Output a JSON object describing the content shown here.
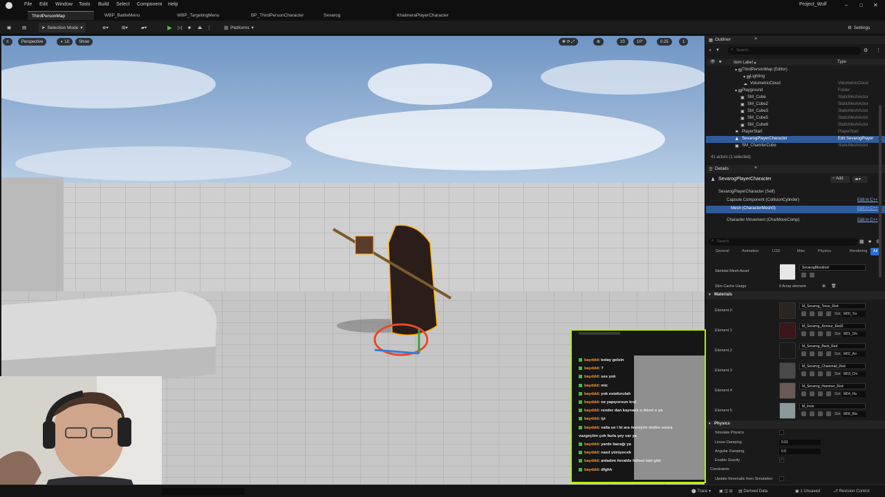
{
  "app": {
    "project": "Project_Wolf"
  },
  "menu": [
    "File",
    "Edit",
    "Window",
    "Tools",
    "Build",
    "Select",
    "Component",
    "Help"
  ],
  "tabs": [
    "ThirdPersonMap",
    "WBP_BattleMenu",
    "WBP_TargetingMenu",
    "BP_ThirdPersonCharacter",
    "Sevarog",
    "KhaimeraPlayerCharacter"
  ],
  "toolbar": {
    "mode": "Selection Mode",
    "platforms": "Platforms",
    "settings": "Settings"
  },
  "viewport": {
    "perspective": "Perspective",
    "lit": "Lit",
    "show": "Show",
    "grid_size": "10",
    "rot_snap": "10°",
    "scale_snap": "0.25",
    "cam_speed": "1"
  },
  "outliner": {
    "title": "Outliner",
    "search_placeholder": "Search",
    "col_label": "Item Label ▴",
    "col_type": "Type",
    "rows": [
      {
        "label": "ThirdPersonMap (Editor)",
        "type": ""
      },
      {
        "label": "Lighting",
        "type": ""
      },
      {
        "label": "VolumetricCloud",
        "type": "VolumetricCloud"
      },
      {
        "label": "Playground",
        "type": "Folder"
      },
      {
        "label": "SM_Cube",
        "type": "StaticMeshActor"
      },
      {
        "label": "SM_Cube2",
        "type": "StaticMeshActor"
      },
      {
        "label": "SM_Cube3",
        "type": "StaticMeshActor"
      },
      {
        "label": "SM_Cube5",
        "type": "StaticMeshActor"
      },
      {
        "label": "SM_Cube6",
        "type": "StaticMeshActor"
      },
      {
        "label": "PlayerStart",
        "type": "PlayerStart"
      },
      {
        "label": "SevarogPlayerCharacter",
        "type": "Edit SevarogPlayer"
      },
      {
        "label": "SM_ChamferCube",
        "type": "StaticMeshActor"
      }
    ],
    "footer": "41 actors (1 selected)"
  },
  "details": {
    "title": "Details",
    "actor": "SevarogPlayerCharacter",
    "add": "Add",
    "components": [
      {
        "label": "SevarogPlayerCharacter (Self)",
        "link": ""
      },
      {
        "label": "Capsule Component (CollisionCylinder)",
        "link": "Edit in C++"
      },
      {
        "label": "Mesh (CharacterMesh0)",
        "link": "Edit in C++"
      },
      {
        "label": "Character Movement (CharMoveComp)",
        "link": "Edit in C++"
      }
    ],
    "search_placeholder": "Search",
    "filter_tabs": [
      "General",
      "Animation",
      "LOD",
      "Misc",
      "Physics",
      "Rendering",
      "All"
    ],
    "skeletal_mesh_label": "Skeletal Mesh Asset",
    "skeletal_mesh_value": "SevarogBloodred",
    "skin_cache_label": "Skin Cache Usage",
    "skin_cache_value": "0 Array element",
    "materials_header": "Materials",
    "materials": [
      {
        "element": "Element 0",
        "name": "M_Sevarog_Torso_Red",
        "slot": "M00_Tor"
      },
      {
        "element": "Element 1",
        "name": "M_Sevarog_Armour_Red2",
        "slot": "M01_Shi"
      },
      {
        "element": "Element 2",
        "name": "M_Sevarog_Back_Red",
        "slot": "M02_Arr"
      },
      {
        "element": "Element 3",
        "name": "M_Sevarog_Chainmail_Red",
        "slot": "M03_Chi"
      },
      {
        "element": "Element 4",
        "name": "M_Sevarog_Hammer_Red",
        "slot": "M04_Ha"
      },
      {
        "element": "Element 5",
        "name": "M_Invis",
        "slot": "M06_Bla"
      }
    ],
    "slot_label": "Slot",
    "physics_header": "Physics",
    "physics": [
      {
        "label": "Simulate Physics",
        "value": ""
      },
      {
        "label": "Linear Damping",
        "value": "0.01"
      },
      {
        "label": "Angular Damping",
        "value": "0.0"
      },
      {
        "label": "Enable Gravity",
        "value": "✓"
      },
      {
        "label": "Constraints",
        "value": ""
      },
      {
        "label": "Update Kinematic from Simulation",
        "value": ""
      }
    ]
  },
  "chat": [
    {
      "user": "bayddd",
      "msg": ": kolay gelsin"
    },
    {
      "user": "bayddd",
      "msg": ": ?"
    },
    {
      "user": "bayddd",
      "msg": ": ses yok"
    },
    {
      "user": "bayddd",
      "msg": ": mic"
    },
    {
      "user": "bayddd",
      "msg": ": yok estafurulah"
    },
    {
      "user": "bayddd",
      "msg": ": ne yapıyorsun kral"
    },
    {
      "user": "bayddd",
      "msg": ": render dan kaynaklı o düzel o ya"
    },
    {
      "user": "bayddd",
      "msg": ": iyi"
    },
    {
      "user": "bayddd",
      "msg": ": valla ue i bi ara öreniyim dedim sonra"
    },
    {
      "user": "",
      "msg": "vazgeçtim çok fazla şey var ya"
    },
    {
      "user": "bayddd",
      "msg": ": yarde bacağı ya"
    },
    {
      "user": "bayddd",
      "msg": ": nasıl yürüyecek"
    },
    {
      "user": "bayddd",
      "msg": ": anladım heralde fallout taki gibi"
    },
    {
      "user": "bayddd",
      "msg": ": dfghh"
    }
  ],
  "status": {
    "trace": "Trace",
    "derived_data": "Derived Data",
    "unsaved": "1 Unsaved",
    "revision": "Revision Control"
  },
  "colors": {
    "accent": "#2f5b9a",
    "chat_border": "#b4f000",
    "play": "#3fbf3f"
  }
}
